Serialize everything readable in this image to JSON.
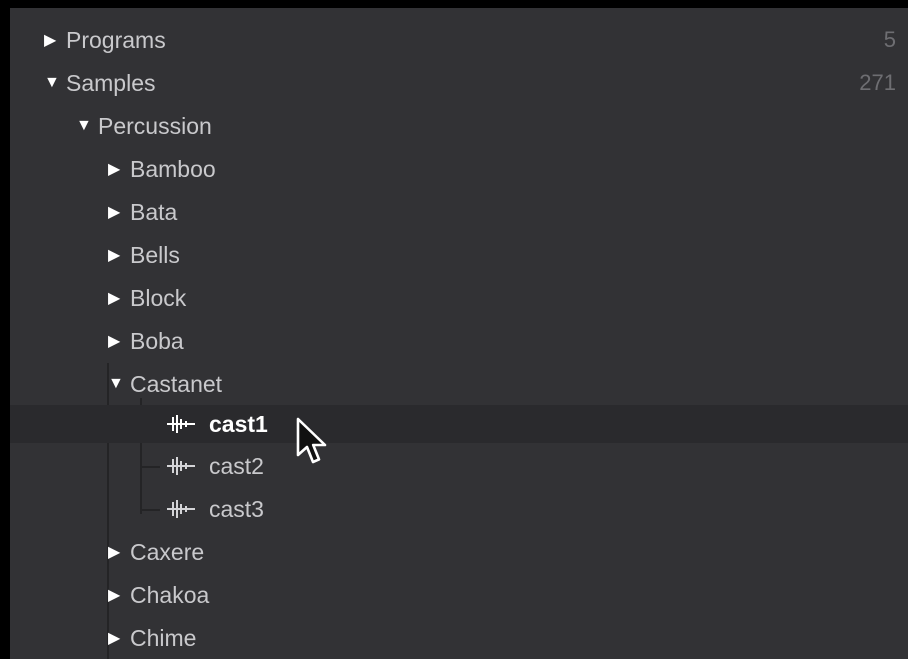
{
  "tree": {
    "programs": {
      "label": "Programs",
      "count": "5",
      "arrow": "▶"
    },
    "samples": {
      "label": "Samples",
      "count": "271",
      "arrow": "▼"
    },
    "percussion": {
      "label": "Percussion",
      "arrow": "▼"
    },
    "folders_before": [
      {
        "label": "Bamboo",
        "arrow": "▶"
      },
      {
        "label": "Bata",
        "arrow": "▶"
      },
      {
        "label": "Bells",
        "arrow": "▶"
      },
      {
        "label": "Block",
        "arrow": "▶"
      },
      {
        "label": "Boba",
        "arrow": "▶"
      }
    ],
    "castanet": {
      "label": "Castanet",
      "arrow": "▼"
    },
    "files": [
      {
        "label": "cast1",
        "selected": true,
        "icon": "waveform-icon"
      },
      {
        "label": "cast2",
        "selected": false,
        "icon": "waveform-icon"
      },
      {
        "label": "cast3",
        "selected": false,
        "icon": "waveform-icon"
      }
    ],
    "folders_after": [
      {
        "label": "Caxere",
        "arrow": "▶"
      },
      {
        "label": "Chakoa",
        "arrow": "▶"
      },
      {
        "label": "Chime",
        "arrow": "▶"
      }
    ]
  },
  "cursor": {
    "icon": "mouse-pointer-icon"
  }
}
